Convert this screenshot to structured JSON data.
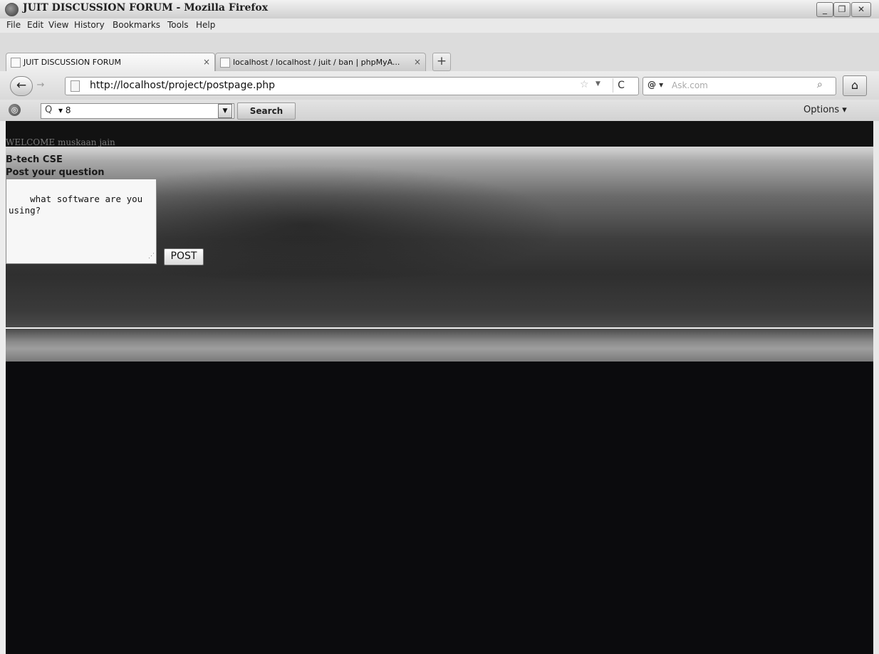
{
  "window": {
    "title": "JUIT DISCUSSION FORUM - Mozilla Firefox",
    "min_glyph": "_",
    "max_glyph": "❐",
    "close_glyph": "✕"
  },
  "menu": {
    "items": [
      "File",
      "Edit",
      "View",
      "History",
      "Bookmarks",
      "Tools",
      "Help"
    ]
  },
  "tabs": [
    {
      "label": "JUIT DISCUSSION FORUM",
      "close": "×"
    },
    {
      "label": "localhost / localhost / juit / ban | phpMyA...",
      "close": "×"
    }
  ],
  "new_tab_glyph": "+",
  "nav": {
    "back_glyph": "←",
    "forward_glyph": "→",
    "url": "http://localhost/project/postpage.php",
    "star_glyph": "☆",
    "dropdown_glyph": "▼",
    "reload_glyph": "C",
    "search_engine_glyph": "@ ▾",
    "search_engine": "Ask.com",
    "search_go_glyph": "⌕",
    "home_glyph": "⌂"
  },
  "toolbar": {
    "globe_glyph": "◎",
    "search_icon_glyph": "Q",
    "search_value": "▾ 8",
    "dropdown_glyph": "▼",
    "search_button": "Search",
    "options_label": "Options ▾"
  },
  "page": {
    "welcome": "WELCOME muskaan jain",
    "subject": "B-tech CSE",
    "post_label": "Post your question",
    "question_text": "what software are you using?",
    "post_button": "POST",
    "resize_glyph": "⋰"
  }
}
